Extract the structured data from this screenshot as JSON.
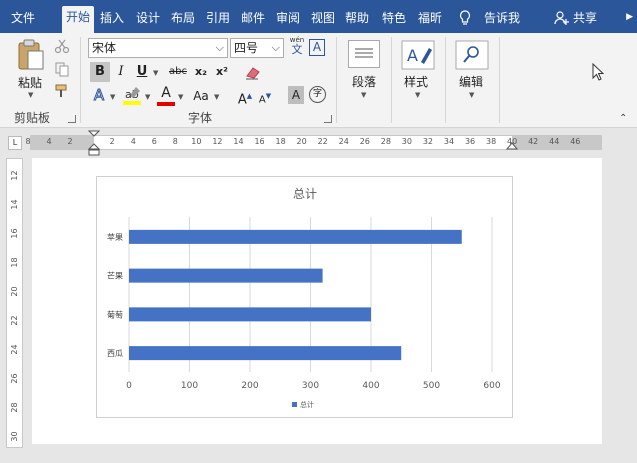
{
  "tabs": [
    "文件",
    "开始",
    "插入",
    "设计",
    "布局",
    "引用",
    "邮件",
    "审阅",
    "视图",
    "帮助",
    "特色",
    "福昕"
  ],
  "active_tab": "开始",
  "tell_me": "告诉我",
  "share": "共享",
  "ribbon": {
    "clipboard": {
      "paste": "粘贴",
      "label": "剪贴板"
    },
    "font": {
      "name": "宋体",
      "size": "四号",
      "label": "字体",
      "bold": "B",
      "italic": "I",
      "underline": "U",
      "strike": "abc",
      "sub": "x₂",
      "sup": "x²",
      "grow": "A",
      "shrink": "A",
      "case": "Aa",
      "shade": "A",
      "circle": "字",
      "phonetic_top": "wén",
      "phonetic_bottom": "文"
    },
    "paragraph": {
      "label": "段落"
    },
    "styles": {
      "label": "样式"
    },
    "editing": {
      "label": "编辑"
    }
  },
  "ruler": {
    "h_marks": [
      "8",
      "4",
      "2",
      "2",
      "4",
      "6",
      "8",
      "10",
      "12",
      "14",
      "16",
      "18",
      "20",
      "22",
      "24",
      "26",
      "28",
      "30",
      "32",
      "34",
      "36",
      "38",
      "40",
      "42",
      "44",
      "46"
    ],
    "v_marks": [
      "12",
      "14",
      "16",
      "18",
      "20",
      "22",
      "24",
      "26",
      "28",
      "30"
    ]
  },
  "chart_data": {
    "type": "bar",
    "orientation": "horizontal",
    "title": "总计",
    "categories": [
      "苹果",
      "芒果",
      "葡萄",
      "西瓜"
    ],
    "series": [
      {
        "name": "总计",
        "values": [
          550,
          320,
          400,
          450
        ]
      }
    ],
    "xlim": [
      0,
      600
    ],
    "xticks": [
      0,
      100,
      200,
      300,
      400,
      500,
      600
    ],
    "grid": true,
    "legend": "bottom",
    "bar_color": "#4472c4"
  }
}
